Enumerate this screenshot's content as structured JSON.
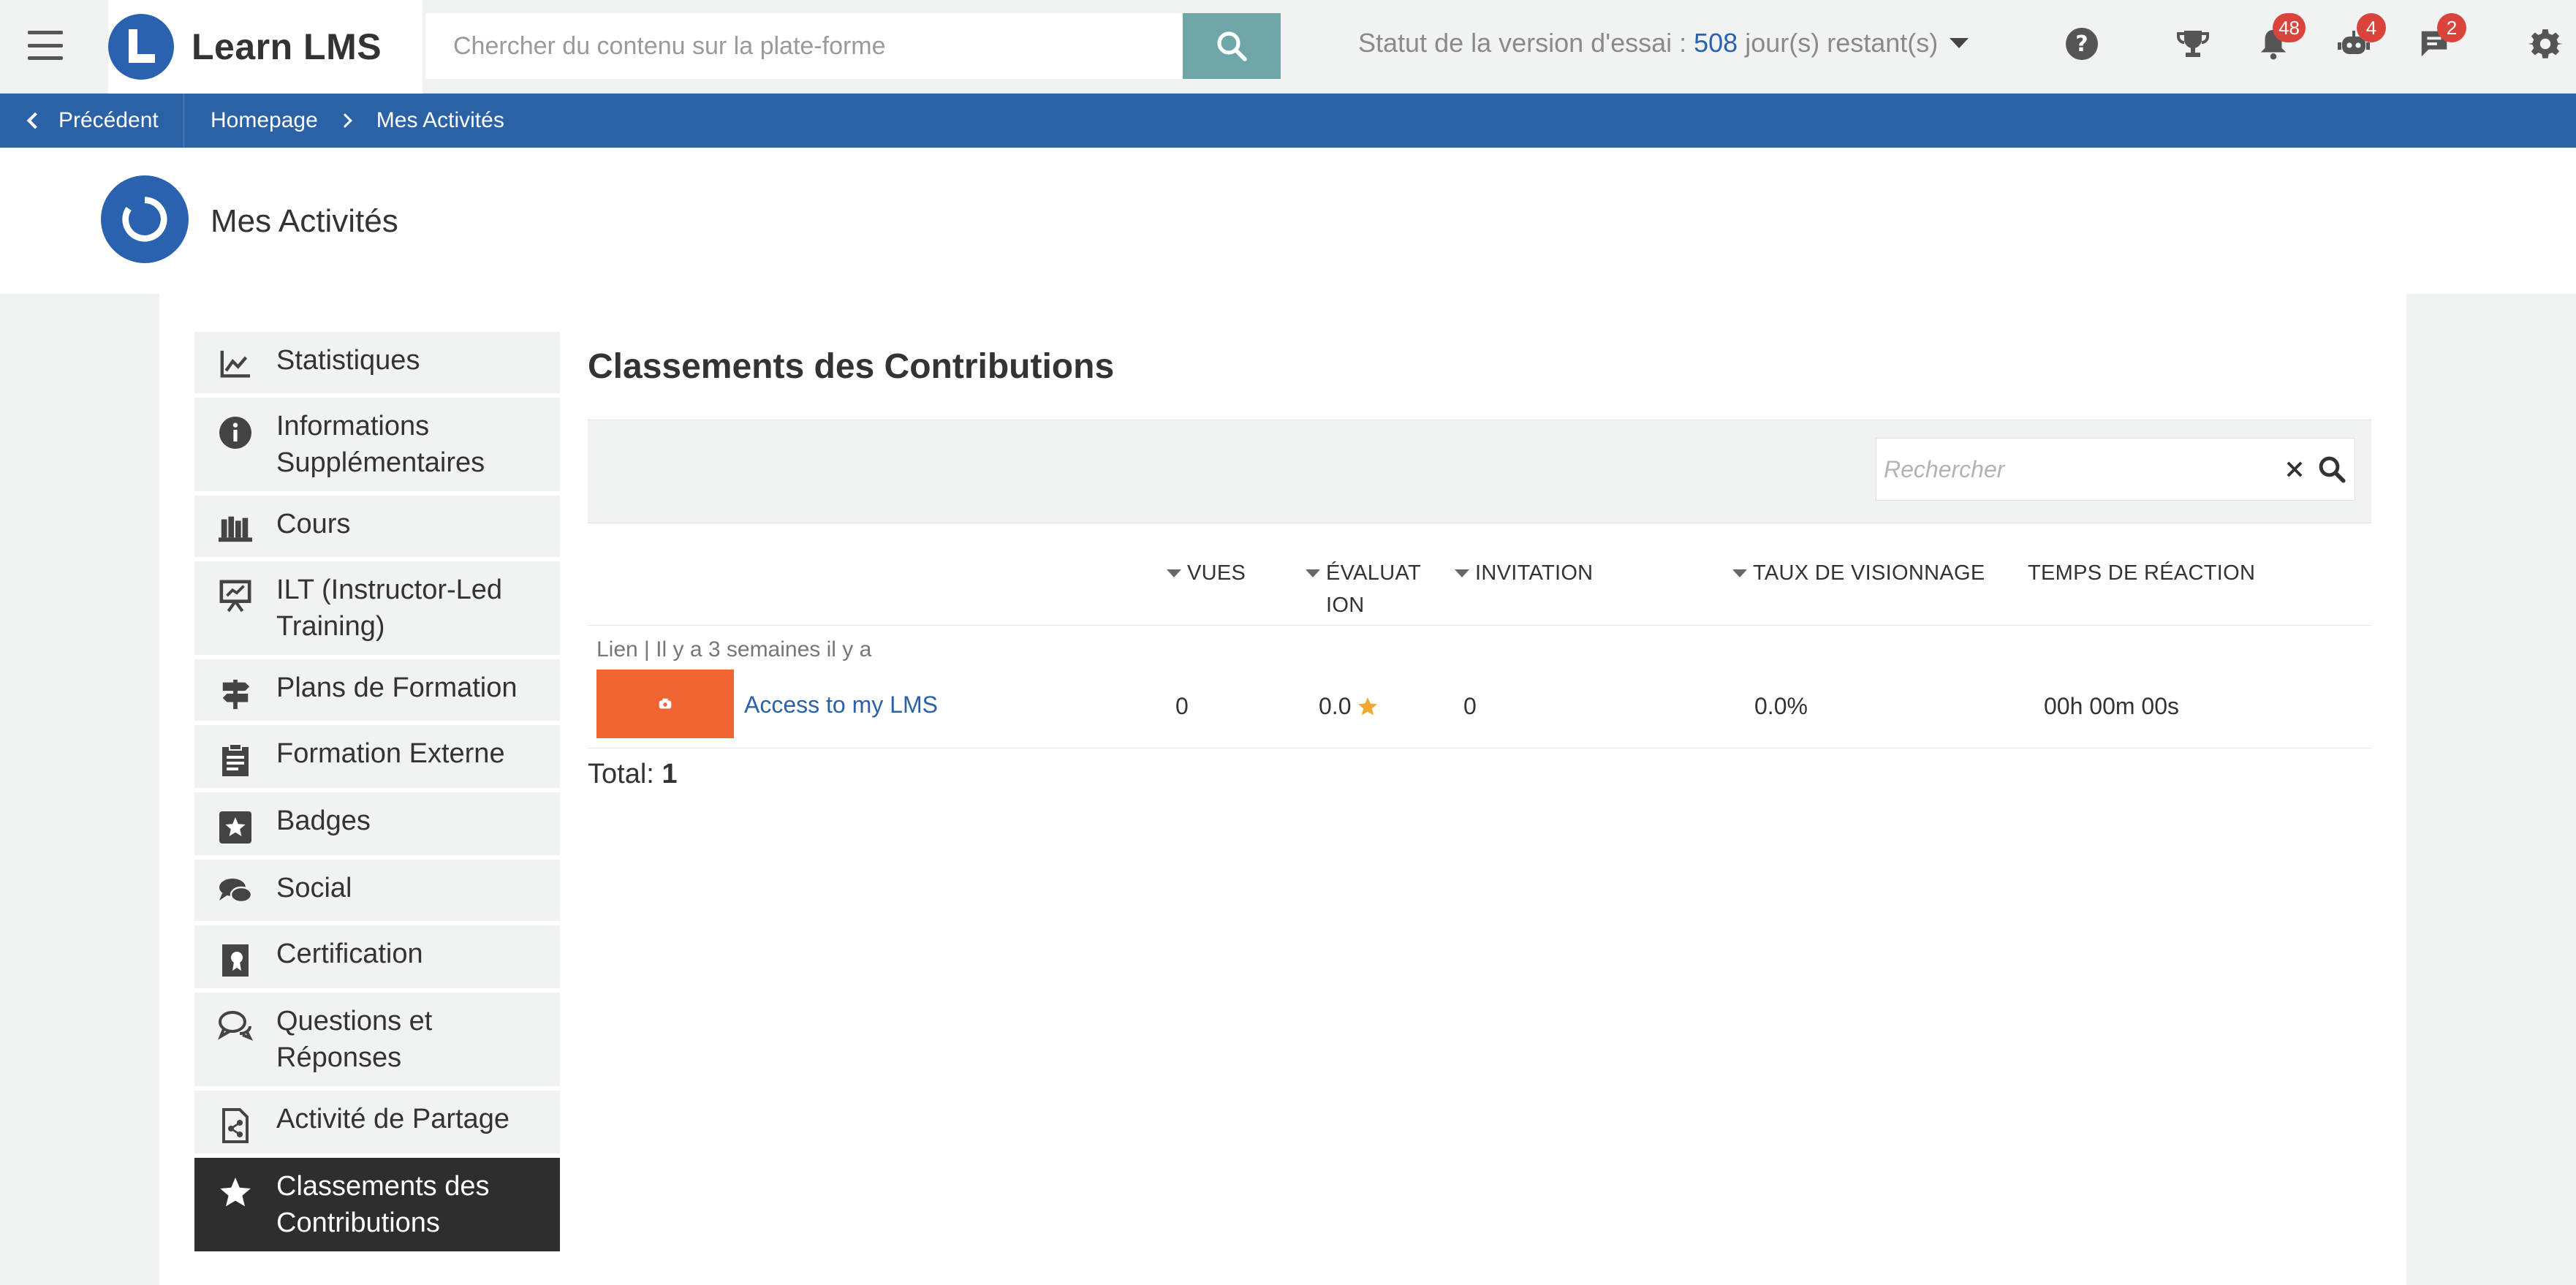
{
  "app": {
    "name": "Learn LMS"
  },
  "topbar": {
    "search_placeholder": "Chercher du contenu sur la plate-forme",
    "trial_prefix": "Statut de la version d'essai :",
    "trial_days": "508",
    "trial_suffix": "jour(s) restant(s)",
    "icons": {
      "help": "help-icon",
      "trophy": "trophy-icon",
      "bell": "bell-icon",
      "robot": "robot-icon",
      "chat": "chat-icon",
      "settings": "gear-icon"
    },
    "badges": {
      "notifications": "48",
      "robot": "4",
      "chat": "2"
    }
  },
  "breadcrumb": {
    "back_label": "Précédent",
    "items": [
      "Homepage",
      "Mes Activités"
    ]
  },
  "page": {
    "title": "Mes Activités"
  },
  "sidebar": {
    "items": [
      {
        "label": "Statistiques",
        "icon": "chart-icon"
      },
      {
        "label": "Informations Supplémentaires",
        "icon": "info-icon"
      },
      {
        "label": "Cours",
        "icon": "books-icon"
      },
      {
        "label": "ILT (Instructor-Led Training)",
        "icon": "presentation-icon"
      },
      {
        "label": "Plans de Formation",
        "icon": "signpost-icon"
      },
      {
        "label": "Formation Externe",
        "icon": "clipboard-icon"
      },
      {
        "label": "Badges",
        "icon": "badge-star-icon"
      },
      {
        "label": "Social",
        "icon": "social-icon"
      },
      {
        "label": "Certification",
        "icon": "certificate-icon"
      },
      {
        "label": "Questions et Réponses",
        "icon": "qa-icon"
      },
      {
        "label": "Activité de Partage",
        "icon": "share-doc-icon"
      },
      {
        "label": "Classements des Contributions",
        "icon": "star-icon",
        "active": true
      }
    ]
  },
  "content": {
    "title": "Classements des Contributions",
    "search_placeholder": "Rechercher",
    "columns": {
      "views": "VUES",
      "rating_line1": "ÉVALUAT",
      "rating_line2": "ION",
      "invitation": "INVITATION",
      "viewing_rate": "TAUX DE VISIONNAGE",
      "reaction_time": "TEMPS DE RÉACTION"
    },
    "rows": [
      {
        "meta": "Lien | Il y a 3 semaines il y a",
        "title": "Access to my LMS",
        "views": "0",
        "rating": "0.0",
        "invitation": "0",
        "viewing_rate": "0.0%",
        "reaction_time": "00h 00m 00s"
      }
    ],
    "total_label": "Total:",
    "total_value": "1"
  },
  "colors": {
    "brand_blue": "#2b62a6",
    "search_button": "#6fa6a8",
    "badge_red": "#d9453c",
    "thumb_orange": "#f06530",
    "star_gold": "#f0a830",
    "active_sidebar": "#2e2e2e"
  }
}
